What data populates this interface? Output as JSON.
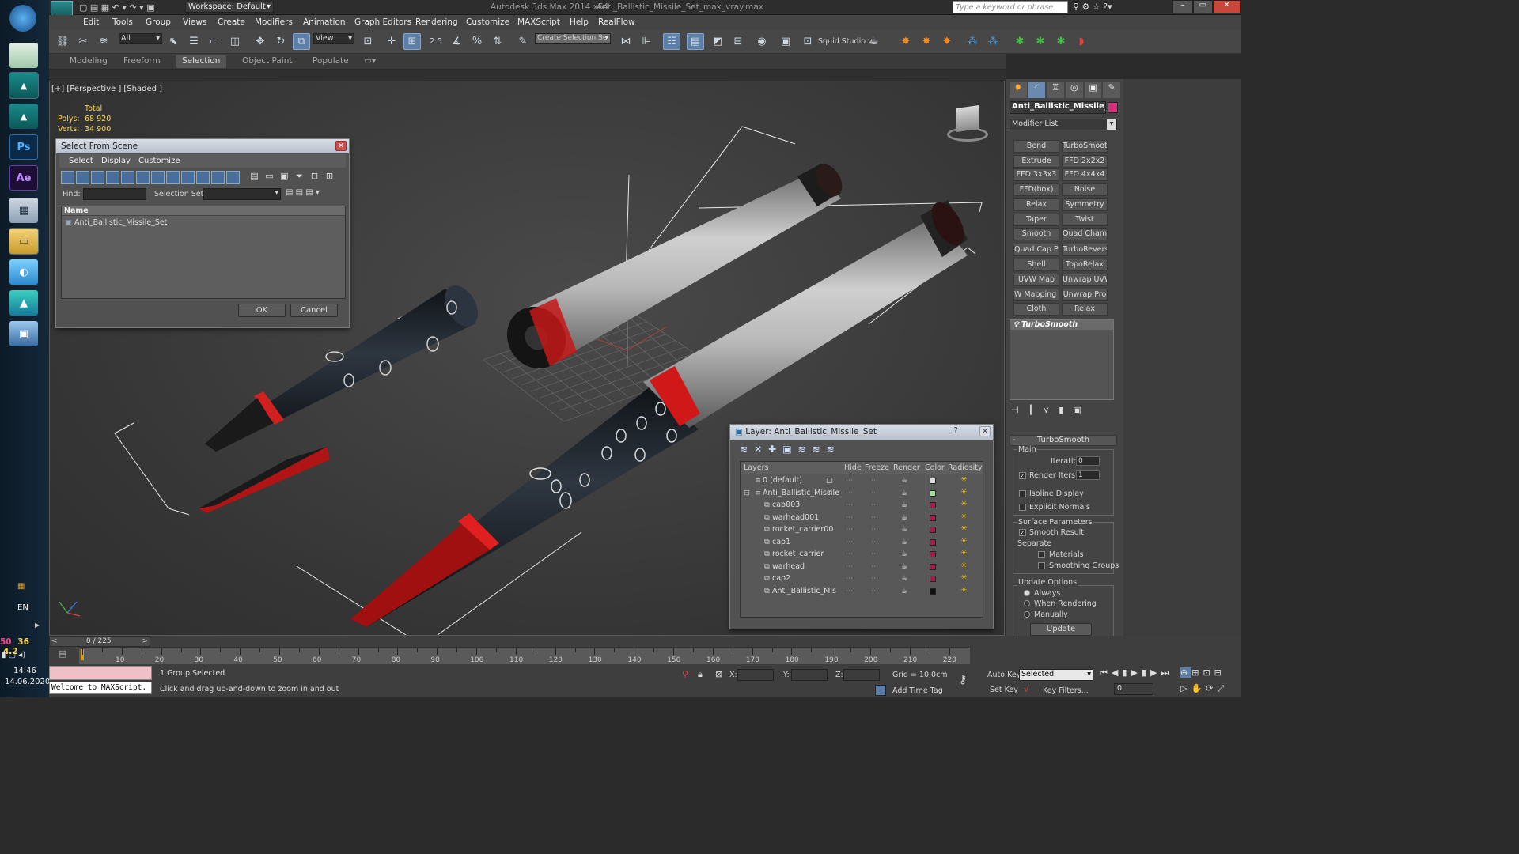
{
  "app": {
    "window_title": "Autodesk 3ds Max  2014 x64",
    "file_title": "Anti_Ballistic_Missile_Set_max_vray.max",
    "workspace": "Workspace: Default",
    "search_placeholder": "Type a keyword or phrase"
  },
  "taskbar": {
    "ps_label": "Ps",
    "ae_label": "Ae",
    "lang": "EN",
    "stats_a": "50",
    "stats_b": "36",
    "stats_c": "4.2",
    "clock_time": "14:46",
    "clock_date": "14.06.2020"
  },
  "menu": [
    "Edit",
    "Tools",
    "Group",
    "Views",
    "Create",
    "Modifiers",
    "Animation",
    "Graph Editors",
    "Rendering",
    "Customize",
    "MAXScript",
    "Help",
    "RealFlow"
  ],
  "toolbar": {
    "filter_value": "All",
    "refcoord_value": "View",
    "snap_value": "2.5",
    "selection_set_placeholder": "Create Selection Se",
    "squid_label": "Squid Studio v"
  },
  "ribbon_tabs": [
    "Modeling",
    "Freeform",
    "Selection",
    "Object Paint",
    "Populate"
  ],
  "viewport": {
    "label": "[+] [Perspective ] [Shaded ]",
    "stats_header": "Total",
    "polys_label": "Polys:",
    "polys_value": "68 920",
    "verts_label": "Verts:",
    "verts_value": "34 900"
  },
  "select_dialog": {
    "title": "Select From Scene",
    "menu": [
      "Select",
      "Display",
      "Customize"
    ],
    "find_label": "Find:",
    "selection_set_label": "Selection Set:",
    "column_name": "Name",
    "items": [
      "Anti_Ballistic_Missile_Set"
    ],
    "ok": "OK",
    "cancel": "Cancel"
  },
  "layer_dialog": {
    "title": "Layer: Anti_Ballistic_Missile_Set",
    "help": "?",
    "columns": [
      "Layers",
      "Hide",
      "Freeze",
      "Render",
      "Color",
      "Radiosity"
    ],
    "rows": [
      {
        "name": "0 (default)",
        "color": "#d8d8d8"
      },
      {
        "name": "Anti_Ballistic_Missile",
        "color": "#9be09b"
      },
      {
        "name": "cap003",
        "color": "#a0204a"
      },
      {
        "name": "warhead001",
        "color": "#a0204a"
      },
      {
        "name": "rocket_carrier00",
        "color": "#a0204a"
      },
      {
        "name": "cap1",
        "color": "#a0204a"
      },
      {
        "name": "rocket_carrier",
        "color": "#a0204a"
      },
      {
        "name": "warhead",
        "color": "#a0204a"
      },
      {
        "name": "cap2",
        "color": "#a0204a"
      },
      {
        "name": "Anti_Ballistic_Mis",
        "color": "#111111"
      }
    ]
  },
  "command_panel": {
    "object_name": "Anti_Ballistic_Missile_Se",
    "object_color": "#d4327a",
    "modifier_list": "Modifier List",
    "modifiers": [
      "Bend",
      "TurboSmooth",
      "Extrude",
      "FFD 2x2x2",
      "FFD 3x3x3",
      "FFD 4x4x4",
      "FFD(box)",
      "Noise",
      "Relax",
      "Symmetry",
      "Taper",
      "Twist",
      "Smooth",
      "Quad Chamfer",
      "Quad Cap Pro",
      "TurboReverse",
      "Shell",
      "TopoRelax",
      "UVW Map",
      "Unwrap UVW",
      "W Mapping Cle",
      "Unwrap Pro",
      "Cloth",
      "Relax"
    ],
    "stack_item": "TurboSmooth",
    "rollout_title": "TurboSmooth",
    "main_group": "Main",
    "iterations_label": "Iterations:",
    "iterations_value": "0",
    "render_iters_label": "Render Iters:",
    "render_iters_value": "1",
    "isoline_label": "Isoline Display",
    "explicit_normals_label": "Explicit Normals",
    "surface_group": "Surface Parameters",
    "smooth_result_label": "Smooth Result",
    "separate_label": "Separate",
    "materials_label": "Materials",
    "smoothing_groups_label": "Smoothing Groups",
    "update_group": "Update Options",
    "always_label": "Always",
    "when_rendering_label": "When Rendering",
    "manually_label": "Manually",
    "update_button": "Update"
  },
  "timeline": {
    "frame_counter": "0 / 225",
    "ticks": [
      "10",
      "20",
      "30",
      "40",
      "50",
      "60",
      "70",
      "80",
      "90",
      "100",
      "110",
      "120",
      "130",
      "140",
      "150",
      "160",
      "170",
      "180",
      "190",
      "200",
      "210",
      "220"
    ]
  },
  "status": {
    "maxscript": "Welcome to MAXScript.",
    "selected": "1 Group Selected",
    "prompt": "Click and drag up-and-down to zoom in and out",
    "x_label": "X:",
    "y_label": "Y:",
    "z_label": "Z:",
    "grid": "Grid = 10,0cm",
    "add_time_tag": "Add Time Tag",
    "auto_key": "Auto Key",
    "set_key": "Set Key",
    "key_mode": "Selected",
    "key_filters": "Key Filters...",
    "frame_value": "0"
  }
}
